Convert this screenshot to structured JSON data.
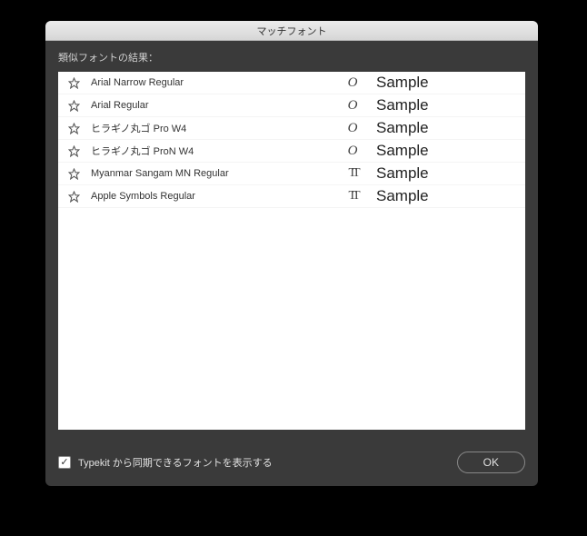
{
  "window": {
    "title": "マッチフォント"
  },
  "subheader": "類似フォントの結果：",
  "fonts": [
    {
      "name": "Arial Narrow Regular",
      "type": "O",
      "sample": "Sample",
      "sampleFamily": "Arial Narrow, Arial, sans-serif"
    },
    {
      "name": "Arial Regular",
      "type": "O",
      "sample": "Sample",
      "sampleFamily": "Arial, sans-serif"
    },
    {
      "name": "ヒラギノ丸ゴ Pro W4",
      "type": "O",
      "sample": "Sample",
      "sampleFamily": "'Hiragino Maru Gothic ProN', sans-serif"
    },
    {
      "name": "ヒラギノ丸ゴ ProN W4",
      "type": "O",
      "sample": "Sample",
      "sampleFamily": "'Hiragino Maru Gothic ProN', sans-serif"
    },
    {
      "name": "Myanmar Sangam MN Regular",
      "type": "T",
      "sample": "Sample",
      "sampleFamily": "'Myanmar Sangam MN', sans-serif"
    },
    {
      "name": "Apple Symbols Regular",
      "type": "T",
      "sample": "Sample",
      "sampleFamily": "'Apple Symbols', sans-serif"
    }
  ],
  "footer": {
    "checkbox_label": "Typekit から同期できるフォントを表示する",
    "checkbox_checked": true,
    "ok_label": "OK"
  }
}
